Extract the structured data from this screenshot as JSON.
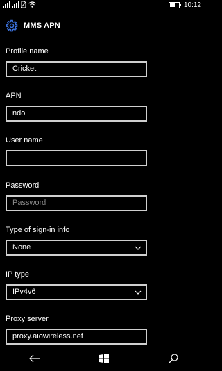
{
  "status_bar": {
    "time": "10:12",
    "battery_level": 0.55,
    "icons": [
      "signal-bars-icon",
      "signal-bars-icon",
      "no-sim-icon",
      "wifi-icon"
    ]
  },
  "header": {
    "title": "MMS APN",
    "icon": "gear-icon"
  },
  "fields": [
    {
      "label": "Profile name",
      "value": "Cricket",
      "placeholder": "",
      "type": "text"
    },
    {
      "label": "APN",
      "value": "ndo",
      "placeholder": "",
      "type": "text"
    },
    {
      "label": "User name",
      "value": "",
      "placeholder": "",
      "type": "text"
    },
    {
      "label": "Password",
      "value": "",
      "placeholder": "Password",
      "type": "password"
    },
    {
      "label": "Type of sign-in info",
      "value": "None",
      "type": "dropdown"
    },
    {
      "label": "IP type",
      "value": "IPv4v6",
      "type": "dropdown"
    },
    {
      "label": "Proxy server",
      "value": "proxy.aiowireless.net",
      "placeholder": "",
      "type": "text"
    }
  ],
  "navbar": {
    "icons": [
      "back-icon",
      "windows-start-icon",
      "search-icon"
    ]
  },
  "colors": {
    "background": "#000000",
    "text": "#ffffff",
    "border": "#cfcfcf",
    "placeholder": "#8a8a8a",
    "accent": "#3a6fd8"
  }
}
